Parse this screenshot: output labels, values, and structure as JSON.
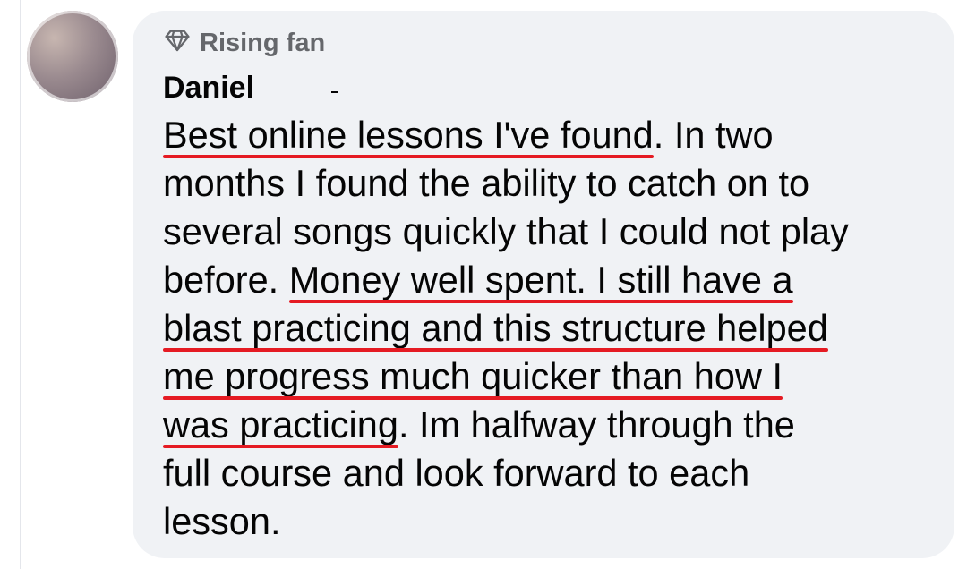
{
  "badge": {
    "icon": "diamond-icon",
    "label": "Rising fan"
  },
  "author": {
    "name": "Daniel"
  },
  "comment": {
    "lines": [
      {
        "hl": "Best online lessons I've found",
        "rest": ". In two"
      },
      {
        "pre": "months I found the ability to catch on to"
      },
      {
        "pre": "several songs quickly that I could not play"
      },
      {
        "pre": "before. ",
        "hl": "Money well spent. I still have a"
      },
      {
        "hl": "blast practicing and this structure helped"
      },
      {
        "hl": "me progress much quicker than how I"
      },
      {
        "hl": "was practicing",
        "rest": ". Im halfway through the"
      },
      {
        "pre": "full course and look forward to each"
      },
      {
        "pre": "lesson."
      }
    ]
  },
  "colors": {
    "bubble": "#f0f2f5",
    "text": "#050505",
    "secondary_text": "#65676b",
    "underline": "#e51b23"
  }
}
